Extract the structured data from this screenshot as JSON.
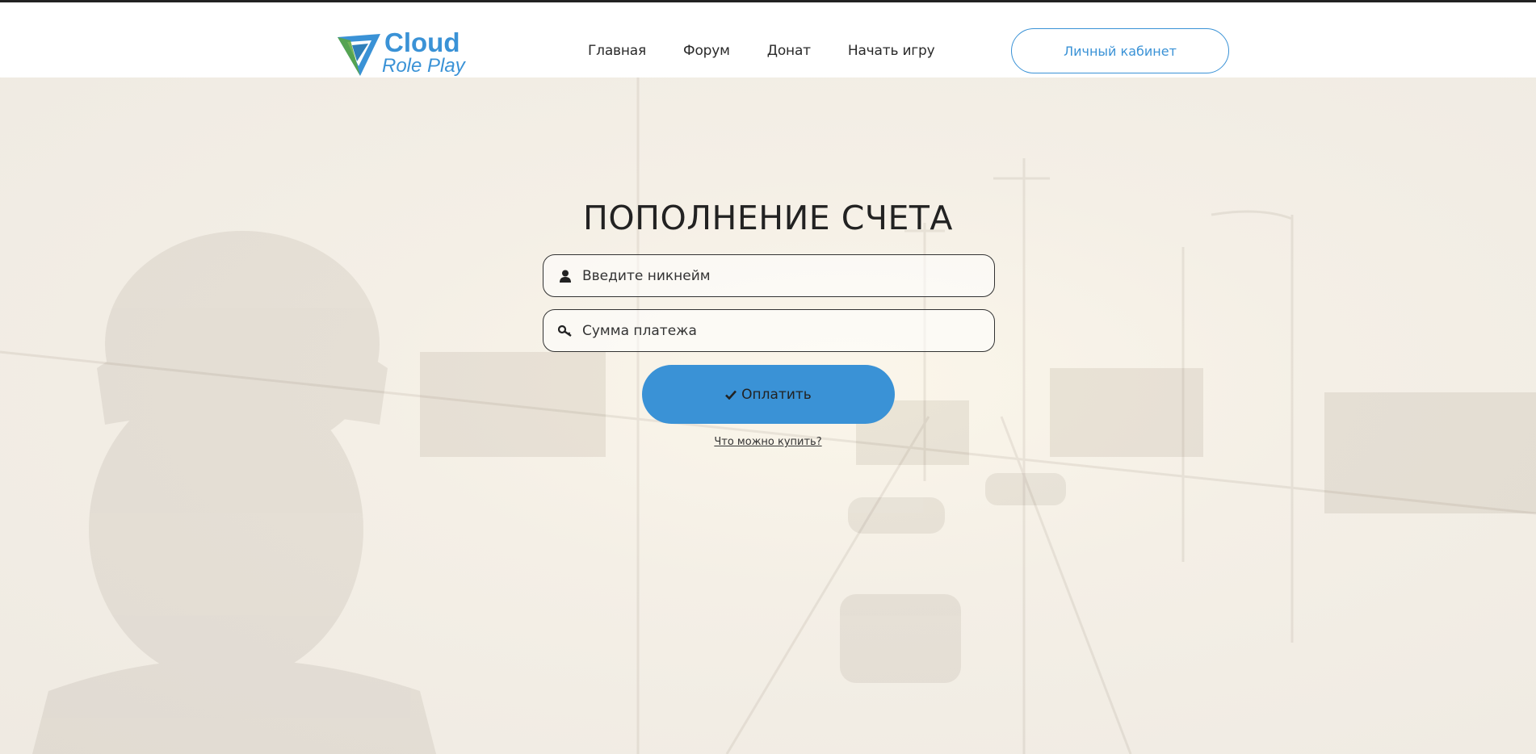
{
  "brand": {
    "line1": "Cloud",
    "line2": "Role Play",
    "color": "#3a92d6"
  },
  "nav": {
    "items": [
      "Главная",
      "Форум",
      "Донат",
      "Начать игру"
    ]
  },
  "header": {
    "cabinet_label": "Личный кабинет"
  },
  "main": {
    "title": "ПОПОЛНЕНИЕ СЧЕТА",
    "nickname_placeholder": "Введите никнейм",
    "amount_placeholder": "Сумма платежа",
    "pay_label": "Оплатить",
    "what_link": "Что можно купить?"
  },
  "icons": [
    "user-icon",
    "key-icon",
    "check-icon",
    "logo-triangle-icon"
  ],
  "colors": {
    "accent": "#3a92d6",
    "text": "#222222"
  }
}
